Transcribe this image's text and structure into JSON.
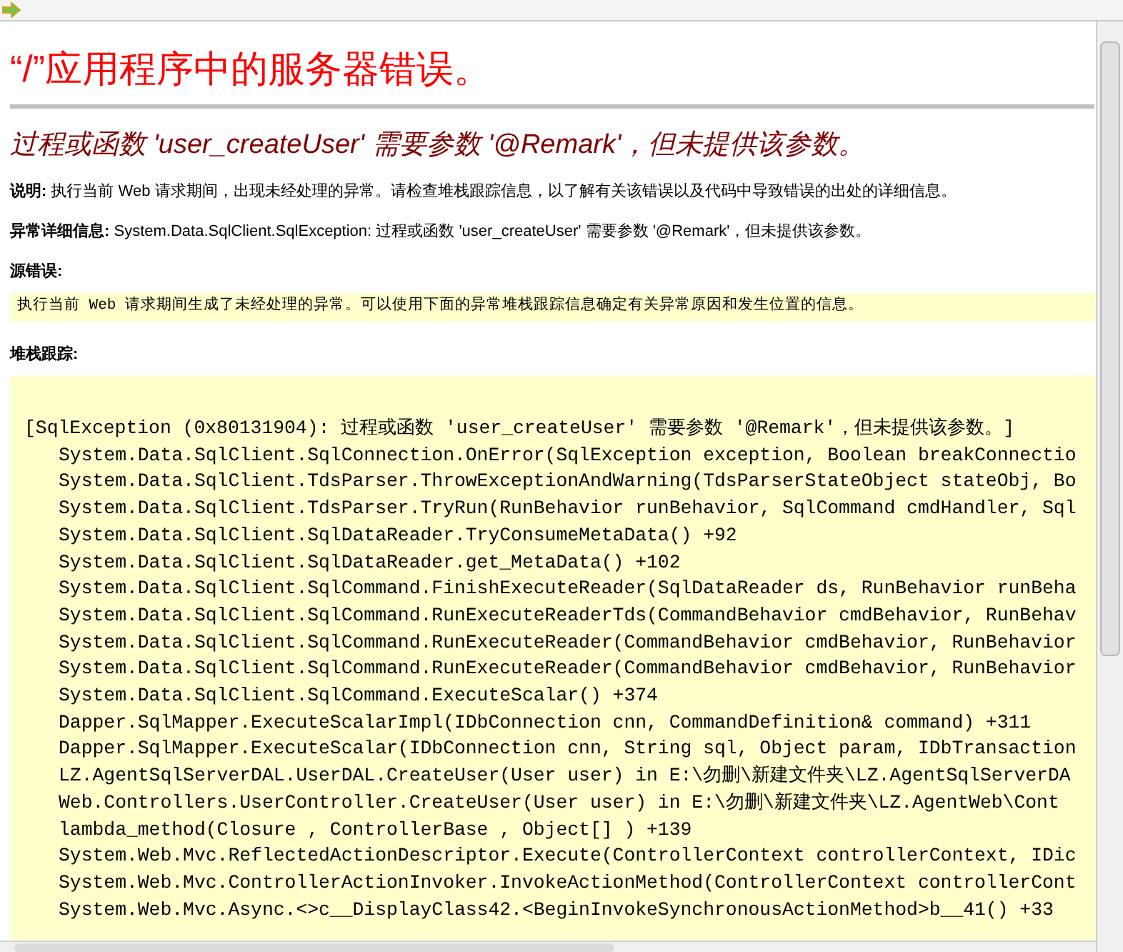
{
  "title": "“/”应用程序中的服务器错误。",
  "error_heading": "过程或函数 'user_createUser' 需要参数 '@Remark'，但未提供该参数。",
  "description": {
    "label": "说明:",
    "text": "执行当前 Web 请求期间，出现未经处理的异常。请检查堆栈跟踪信息，以了解有关该错误以及代码中导致错误的出处的详细信息。"
  },
  "exception_details": {
    "label": "异常详细信息:",
    "text": "System.Data.SqlClient.SqlException: 过程或函数 'user_createUser' 需要参数 '@Remark'，但未提供该参数。"
  },
  "source_error": {
    "label": "源错误:",
    "text": "执行当前 Web 请求期间生成了未经处理的异常。可以使用下面的异常堆栈跟踪信息确定有关异常原因和发生位置的信息。"
  },
  "stack_trace": {
    "label": "堆栈跟踪:",
    "header": "[SqlException (0x80131904): 过程或函数 'user_createUser' 需要参数 '@Remark'，但未提供该参数。]",
    "frames": [
      "System.Data.SqlClient.SqlConnection.OnError(SqlException exception, Boolean breakConnectio",
      "System.Data.SqlClient.TdsParser.ThrowExceptionAndWarning(TdsParserStateObject stateObj, Bo",
      "System.Data.SqlClient.TdsParser.TryRun(RunBehavior runBehavior, SqlCommand cmdHandler, Sql",
      "System.Data.SqlClient.SqlDataReader.TryConsumeMetaData() +92",
      "System.Data.SqlClient.SqlDataReader.get_MetaData() +102",
      "System.Data.SqlClient.SqlCommand.FinishExecuteReader(SqlDataReader ds, RunBehavior runBeha",
      "System.Data.SqlClient.SqlCommand.RunExecuteReaderTds(CommandBehavior cmdBehavior, RunBehav",
      "System.Data.SqlClient.SqlCommand.RunExecuteReader(CommandBehavior cmdBehavior, RunBehavior",
      "System.Data.SqlClient.SqlCommand.RunExecuteReader(CommandBehavior cmdBehavior, RunBehavior",
      "System.Data.SqlClient.SqlCommand.ExecuteScalar() +374",
      "Dapper.SqlMapper.ExecuteScalarImpl(IDbConnection cnn, CommandDefinition& command) +311",
      "Dapper.SqlMapper.ExecuteScalar(IDbConnection cnn, String sql, Object param, IDbTransaction",
      "LZ.AgentSqlServerDAL.UserDAL.CreateUser(User user) in E:\\勿删\\新建文件夹\\LZ.AgentSqlServerDA",
      "Web.Controllers.UserController.CreateUser(User user) in E:\\勿删\\新建文件夹\\LZ.AgentWeb\\Cont",
      "lambda_method(Closure , ControllerBase , Object[] ) +139",
      "System.Web.Mvc.ReflectedActionDescriptor.Execute(ControllerContext controllerContext, IDic",
      "System.Web.Mvc.ControllerActionInvoker.InvokeActionMethod(ControllerContext controllerCont",
      "System.Web.Mvc.Async.<>c__DisplayClass42.<BeginInvokeSynchronousActionMethod>b__41() +33"
    ]
  }
}
